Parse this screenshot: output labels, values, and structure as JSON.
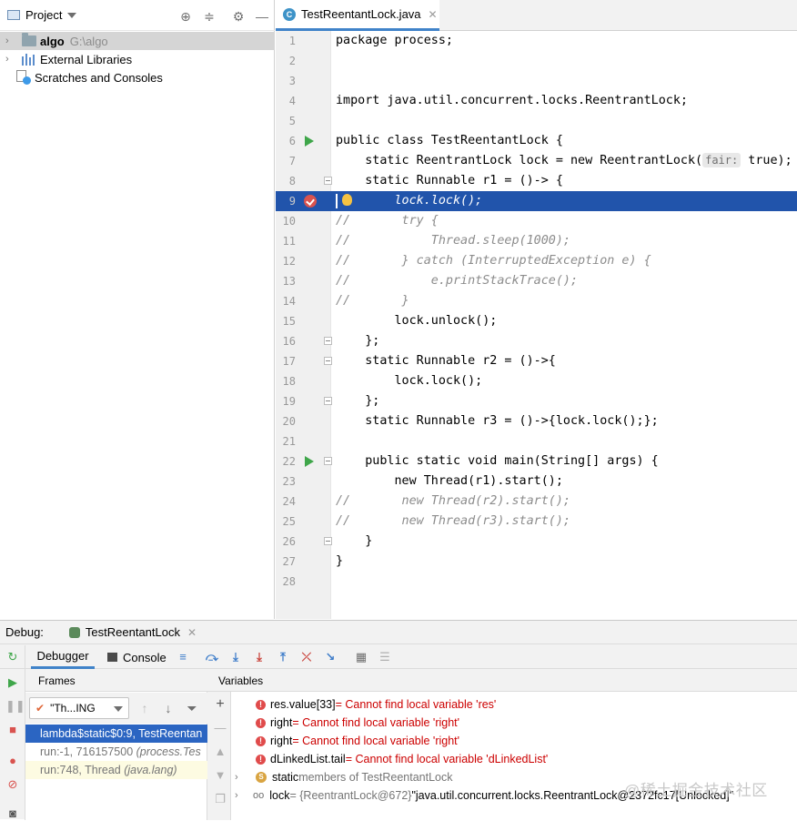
{
  "project": {
    "title": "Project",
    "tree": [
      {
        "label": "algo",
        "path": "G:\\algo",
        "selected": true
      },
      {
        "label": "External Libraries"
      },
      {
        "label": "Scratches and Consoles"
      }
    ]
  },
  "editor": {
    "tab_label": "TestReentantLock.java",
    "class_icon_letter": "C",
    "lines": [
      {
        "n": "1",
        "text": "package process;"
      },
      {
        "n": "2",
        "text": ""
      },
      {
        "n": "3",
        "text": ""
      },
      {
        "n": "4",
        "text": "import java.util.concurrent.locks.ReentrantLock;"
      },
      {
        "n": "5",
        "text": ""
      },
      {
        "n": "6",
        "text": "public class TestReentantLock {"
      },
      {
        "n": "7",
        "text": "    static ReentrantLock lock = new ReentrantLock("
      },
      {
        "n": "7b",
        "hint": "fair:",
        "text": " true);"
      },
      {
        "n": "8",
        "text": "    static Runnable r1 = ()-> {"
      },
      {
        "n": "9",
        "text": "        lock.lock();"
      },
      {
        "n": "10",
        "text": "//       try {"
      },
      {
        "n": "11",
        "text": "//           Thread.sleep(1000);"
      },
      {
        "n": "12",
        "text": "//       } catch (InterruptedException e) {"
      },
      {
        "n": "13",
        "text": "//           e.printStackTrace();"
      },
      {
        "n": "14",
        "text": "//       }"
      },
      {
        "n": "15",
        "text": "        lock.unlock();"
      },
      {
        "n": "16",
        "text": "    };"
      },
      {
        "n": "17",
        "text": "    static Runnable r2 = ()->{"
      },
      {
        "n": "18",
        "text": "        lock.lock();"
      },
      {
        "n": "19",
        "text": "    };"
      },
      {
        "n": "20",
        "text": "    static Runnable r3 = ()->{lock.lock();};"
      },
      {
        "n": "21",
        "text": ""
      },
      {
        "n": "22",
        "text": "    public static void main(String[] args) {"
      },
      {
        "n": "23",
        "text": "        new Thread(r1).start();"
      },
      {
        "n": "24",
        "text": "//       new Thread(r2).start();"
      },
      {
        "n": "25",
        "text": "//       new Thread(r3).start();"
      },
      {
        "n": "26",
        "text": "    }"
      },
      {
        "n": "27",
        "text": "}"
      },
      {
        "n": "28",
        "text": ""
      }
    ]
  },
  "debug": {
    "label": "Debug:",
    "session_tab": "TestReentantLock",
    "tabs": {
      "debugger": "Debugger",
      "console": "Console"
    },
    "frames_header": "Frames",
    "variables_header": "Variables",
    "thread_select": "\"Th...ING",
    "frames": [
      {
        "text": "lambda$static$0:9, TestReentan"
      },
      {
        "text": "run:-1, 716157500 ",
        "italic": "(process.Tes"
      },
      {
        "text": "run:748, Thread ",
        "italic": "(java.lang)"
      }
    ],
    "variables": [
      {
        "name": "res.value[33]",
        "value": " = Cannot find local variable 'res'"
      },
      {
        "name": "right",
        "value": " = Cannot find local variable 'right'"
      },
      {
        "name": "right",
        "value": " = Cannot find local variable 'right'"
      },
      {
        "name": "dLinkedList.tail",
        "value": " = Cannot find local variable 'dLinkedList'"
      },
      {
        "prefix": "static",
        "text": " members of TestReentantLock"
      },
      {
        "name": "lock",
        "ref": " = {ReentrantLock@672} ",
        "value": "\"java.util.concurrent.locks.ReentrantLock@2372fc17[Unlocked]\""
      }
    ]
  },
  "watermark": "@稀土掘金技术社区"
}
